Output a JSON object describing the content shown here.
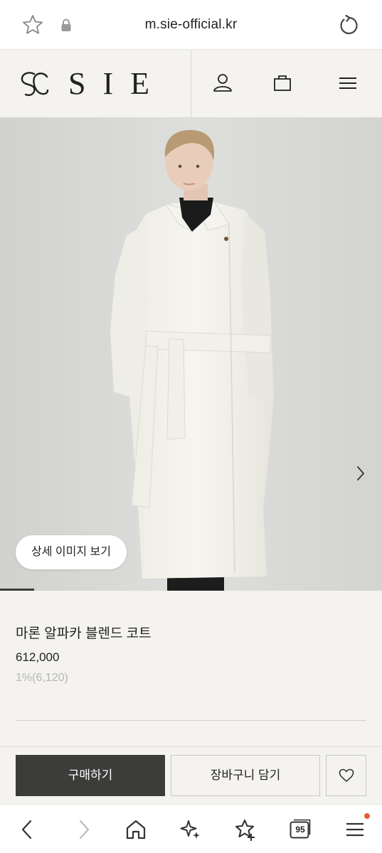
{
  "browser": {
    "url": "m.sie-official.kr",
    "tab_count": "95",
    "notification_color": "#e2622f"
  },
  "header": {
    "brand": "SIE",
    "icons": [
      "user-icon",
      "bag-icon",
      "menu-icon"
    ]
  },
  "hero": {
    "detail_button_label": "상세 이미지 보기",
    "slide_progress": 0.09
  },
  "product": {
    "name": "마론 알파카 블렌드 코트",
    "price": "612,000",
    "points": "1%(6,120)"
  },
  "actions": {
    "buy_label": "구매하기",
    "cart_label": "장바구니 담기"
  },
  "colors": {
    "buy_button": "#3c3c3b",
    "page_background": "#f4f3ef",
    "points_text": "#b5b5b5"
  }
}
